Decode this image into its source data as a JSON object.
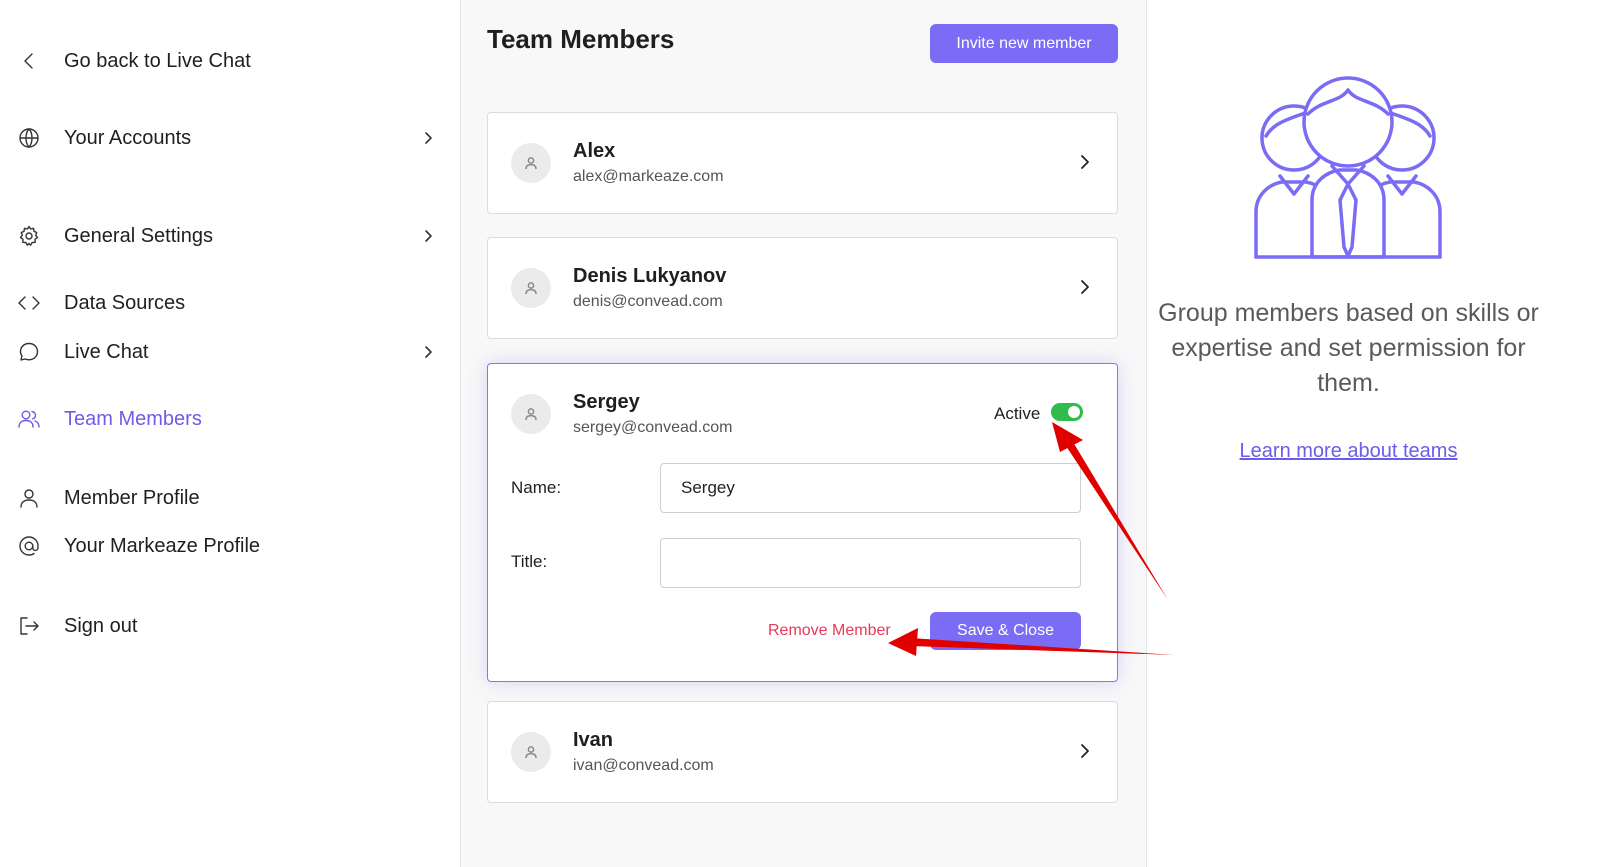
{
  "sidebar": {
    "items": [
      {
        "label": "Go back to Live Chat",
        "icon": "chevron-left-icon",
        "has_chevron": false
      },
      {
        "label": "Your Accounts",
        "icon": "globe-icon",
        "has_chevron": true
      },
      {
        "label": "General Settings",
        "icon": "gear-icon",
        "has_chevron": true
      },
      {
        "label": "Data Sources",
        "icon": "code-icon",
        "has_chevron": false
      },
      {
        "label": "Live Chat",
        "icon": "chat-bubble-icon",
        "has_chevron": true
      },
      {
        "label": "Team Members",
        "icon": "users-icon",
        "has_chevron": false,
        "active": true
      },
      {
        "label": "Member Profile",
        "icon": "user-icon",
        "has_chevron": false
      },
      {
        "label": "Your Markeaze Profile",
        "icon": "at-sign-icon",
        "has_chevron": false
      },
      {
        "label": "Sign out",
        "icon": "sign-out-icon",
        "has_chevron": false
      }
    ]
  },
  "main": {
    "title": "Team Members",
    "invite_label": "Invite new member",
    "members": [
      {
        "name": "Alex",
        "email": "alex@markeaze.com"
      },
      {
        "name": "Denis Lukyanov",
        "email": "denis@convead.com"
      },
      {
        "name": "Sergey",
        "email": "sergey@convead.com",
        "expanded": true,
        "status_label": "Active",
        "active": true
      },
      {
        "name": "Ivan",
        "email": "ivan@convead.com"
      }
    ],
    "edit_form": {
      "name_label": "Name:",
      "name_value": "Sergey",
      "title_label": "Title:",
      "title_value": "",
      "remove_label": "Remove Member",
      "save_label": "Save & Close"
    }
  },
  "right_panel": {
    "illustration": "team-group-icon",
    "info_text": "Group members based on skills or expertise and set permission for them.",
    "learn_more": "Learn more about teams"
  },
  "colors": {
    "accent": "#7a6cf5",
    "toggle_on": "#2ebd4b",
    "danger": "#e53a5a",
    "annotation_arrow": "#e00000"
  }
}
